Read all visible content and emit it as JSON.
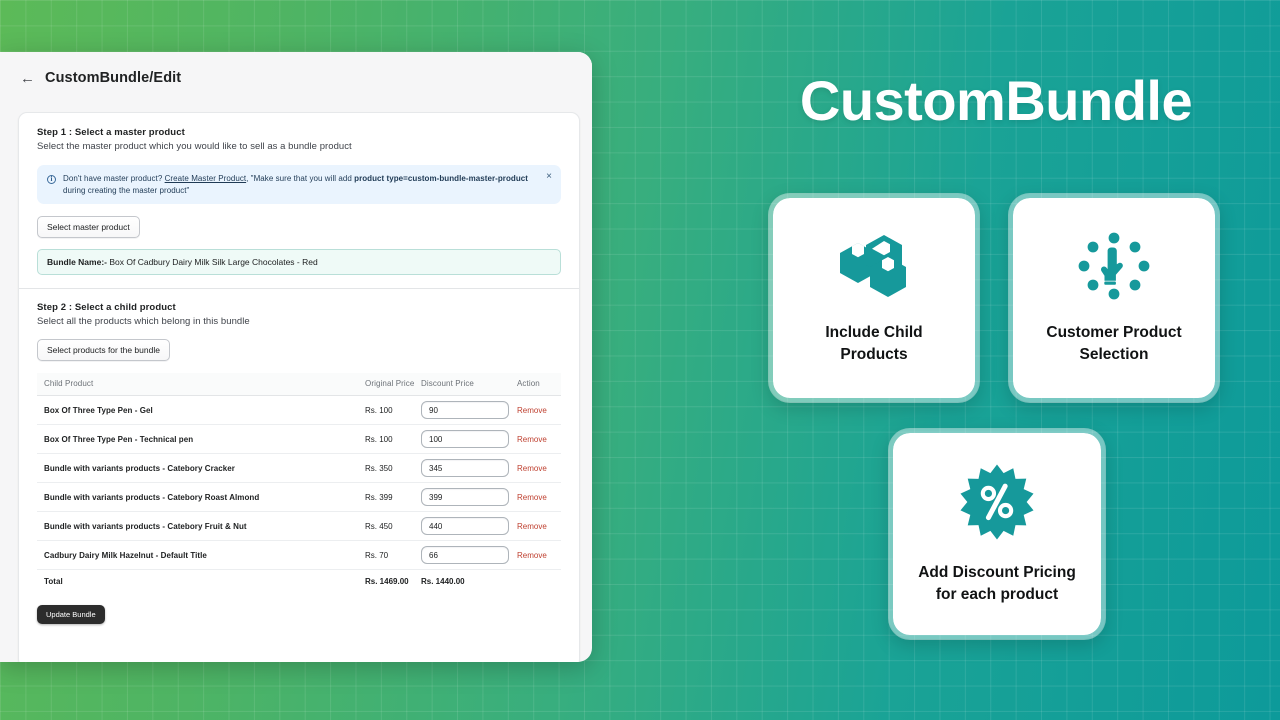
{
  "theme": {
    "brand_teal": "#16999b",
    "gradient_start": "#5cba58",
    "gradient_end": "#0d9a9a",
    "remove_red": "#bf4030",
    "dark_button": "#2c2c2c"
  },
  "app": {
    "back_arrow": "←",
    "page_title": "CustomBundle/Edit"
  },
  "step1": {
    "title": "Step 1 : Select a master product",
    "subtitle": "Select the master product which you would like to sell as a bundle product",
    "banner": {
      "icon": "ⓘ",
      "lead": "Don't have master product?",
      "link": "Create Master Product",
      "mid": ", \"Make sure that you will add ",
      "bold": "product type=custom-bundle-master-product",
      "tail": " during creating the master product\"",
      "close": "×"
    },
    "select_master_button": "Select master product",
    "bundle_name_label": "Bundle Name:-",
    "bundle_name_value": "Box Of Cadbury Dairy Milk Silk Large Chocolates - Red"
  },
  "step2": {
    "title": "Step 2 : Select a child product",
    "subtitle": "Select all the products which belong in this bundle",
    "select_products_button": "Select products for the bundle",
    "table": {
      "headers": [
        "Child Product",
        "Original Price",
        "Discount Price",
        "Action"
      ],
      "rows": [
        {
          "product": "Box Of Three Type Pen - Gel",
          "original": "Rs. 100",
          "discount": "90",
          "action": "Remove"
        },
        {
          "product": "Box Of Three Type Pen - Technical pen",
          "original": "Rs. 100",
          "discount": "100",
          "action": "Remove"
        },
        {
          "product": "Bundle with variants products - Catebory Cracker",
          "original": "Rs. 350",
          "discount": "345",
          "action": "Remove"
        },
        {
          "product": "Bundle with variants products - Catebory Roast Almond",
          "original": "Rs. 399",
          "discount": "399",
          "action": "Remove"
        },
        {
          "product": "Bundle with variants products - Catebory Fruit & Nut",
          "original": "Rs. 450",
          "discount": "440",
          "action": "Remove"
        },
        {
          "product": "Cadbury Dairy Milk Hazelnut - Default Title",
          "original": "Rs. 70",
          "discount": "66",
          "action": "Remove"
        }
      ],
      "total": {
        "label": "Total",
        "original": "Rs. 1469.00",
        "discount": "Rs. 1440.00"
      }
    },
    "update_button": "Update Bundle"
  },
  "hero": {
    "title": "CustomBundle",
    "cards": [
      {
        "icon": "boxes-icon",
        "line1": "Include Child",
        "line2": "Products"
      },
      {
        "icon": "hand-pointer-icon",
        "line1": "Customer Product",
        "line2": "Selection"
      },
      {
        "icon": "percent-badge-icon",
        "line1": "Add Discount Pricing",
        "line2": "for each product"
      }
    ]
  }
}
